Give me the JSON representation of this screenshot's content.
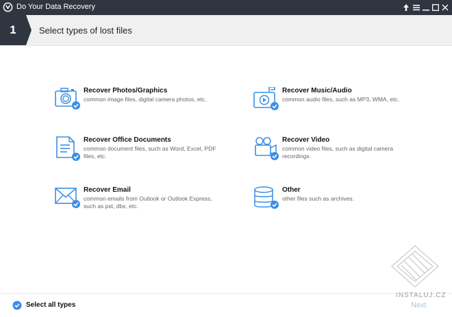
{
  "window": {
    "title": "Do Your Data Recovery"
  },
  "step": {
    "number": "1",
    "title": "Select types of lost files"
  },
  "options": [
    {
      "label": "Recover Photos/Graphics",
      "desc": "common image files, digital camera photos, etc.",
      "icon": "camera-icon",
      "checked": true
    },
    {
      "label": "Recover Music/Audio",
      "desc": "common audio files, such as MP3, WMA, etc.",
      "icon": "music-icon",
      "checked": true
    },
    {
      "label": "Recover Office Documents",
      "desc": "common document files, such as Word, Excel, PDF files, etc.",
      "icon": "document-icon",
      "checked": true
    },
    {
      "label": "Recover Video",
      "desc": "common video files, such as digital camera recordings.",
      "icon": "video-camera-icon",
      "checked": true
    },
    {
      "label": "Recover Email",
      "desc": "common emails from Outlook or Outlook Express, such as pst, dbx, etc.",
      "icon": "envelope-icon",
      "checked": true
    },
    {
      "label": "Other",
      "desc": "other files such as archives.",
      "icon": "database-icon",
      "checked": true
    }
  ],
  "footer": {
    "select_all": "Select all types",
    "next": "Next",
    "watermark": "INSTALUJ.CZ"
  },
  "colors": {
    "accent": "#3a8ee6",
    "titlebar": "#2f3640",
    "step_badge": "#2f3640"
  }
}
